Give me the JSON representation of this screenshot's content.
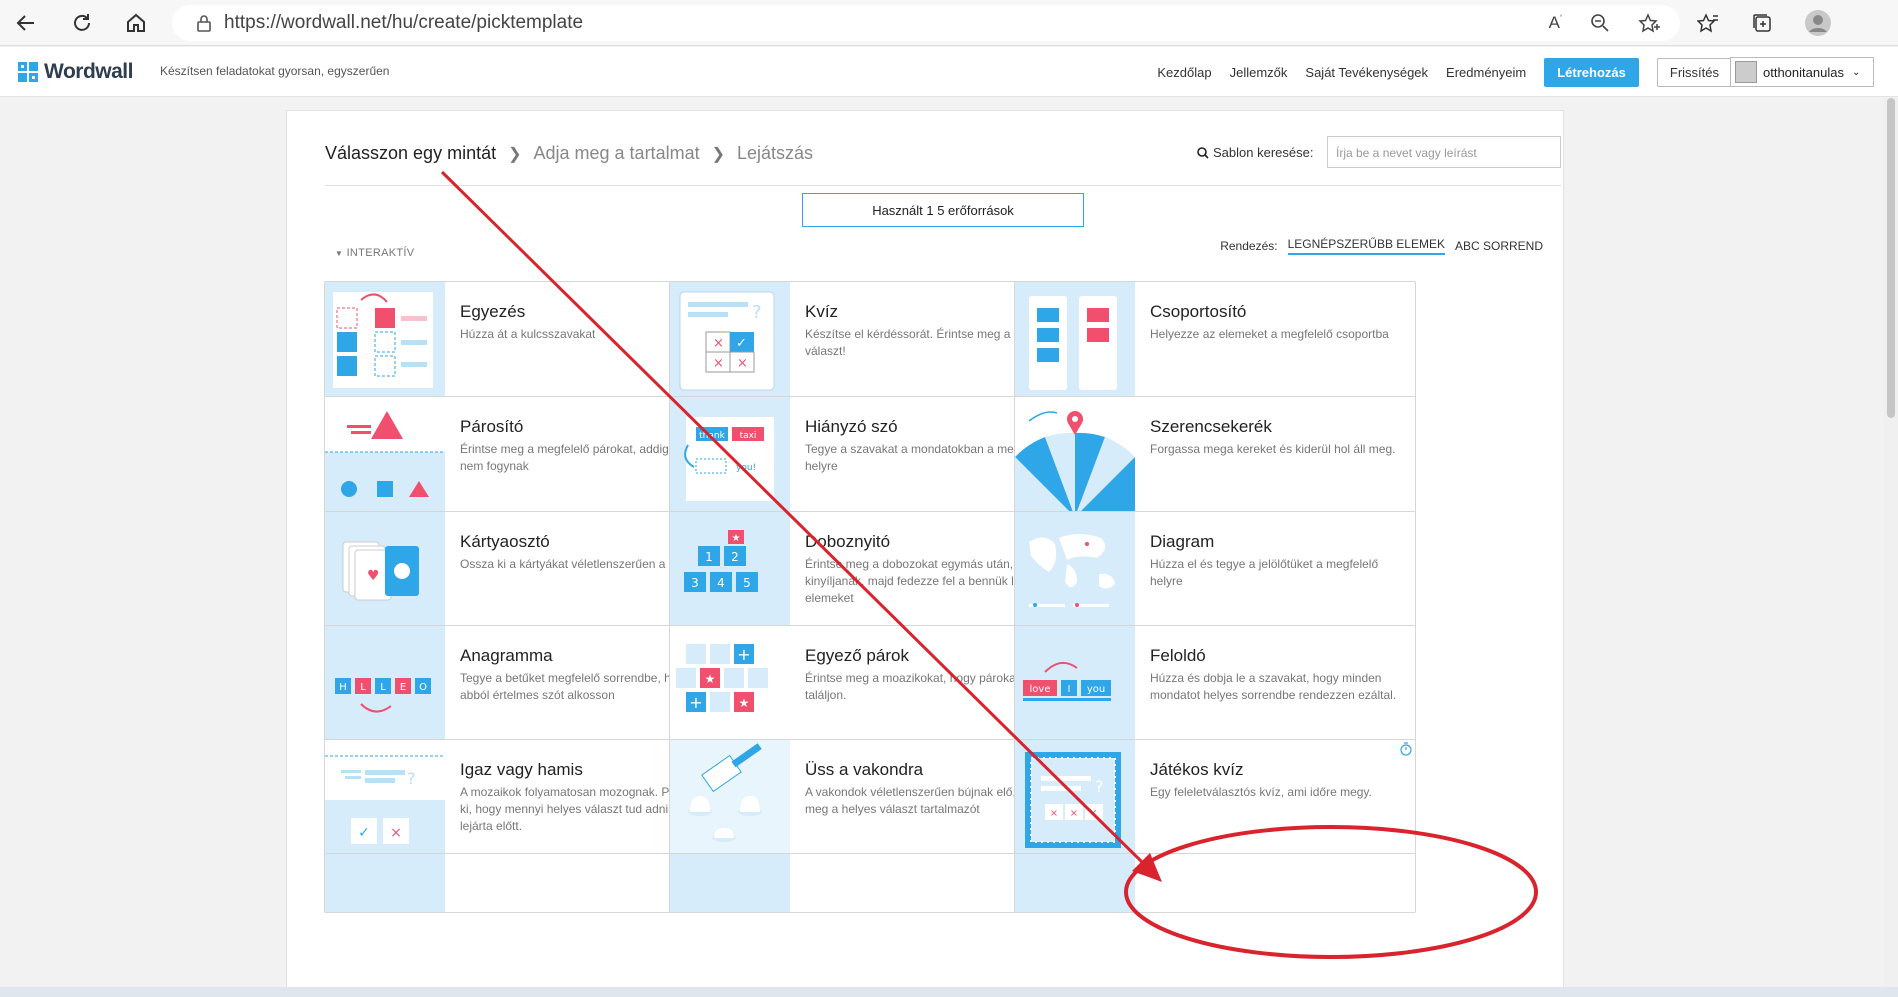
{
  "browser": {
    "url": "https://wordwall.net/hu/create/picktemplate"
  },
  "header": {
    "logo": "Wordwall",
    "tagline": "Készítsen feladatokat gyorsan, egyszerűen",
    "nav": [
      "Kezdőlap",
      "Jellemzők",
      "Saját Tevékenységek",
      "Eredményeim"
    ],
    "create_label": "Létrehozás",
    "upgrade_label": "Frissítés",
    "username": "otthonitanulas"
  },
  "breadcrumb": {
    "step1": "Válasszon egy mintát",
    "step2": "Adja meg a tartalmat",
    "step3": "Lejátszás"
  },
  "search": {
    "label": "Sablon keresése:",
    "placeholder": "Írja be a nevet vagy leírást"
  },
  "resources": "Használt 1 5 erőforrások",
  "section": "INTERAKTÍV",
  "sort": {
    "label": "Rendezés:",
    "popular": "LEGNÉPSZERŰBB ELEMEK",
    "abc": "ABC SORREND"
  },
  "templates": [
    {
      "title": "Egyezés",
      "desc": "Húzza át a kulcsszavakat"
    },
    {
      "title": "Kvíz",
      "desc": "Készítse el kérdéssorát. Érintse meg a helyes választ!"
    },
    {
      "title": "Csoportosító",
      "desc": "Helyezze az elemeket a megfelelő csoportba"
    },
    {
      "title": "Párosító",
      "desc": "Érintse meg a megfelelő párokat, addig, míg el nem fogynak"
    },
    {
      "title": "Hiányzó szó",
      "desc": "Tegye a szavakat a mondatokban a megfelelő helyre"
    },
    {
      "title": "Szerencsekerék",
      "desc": "Forgassa mega kereket és kiderül hol áll meg."
    },
    {
      "title": "Kártyaosztó",
      "desc": "Ossza ki a kártyákat véletlenszerűen a pakliból"
    },
    {
      "title": "Doboznyitó",
      "desc": "Érintse meg a dobozokat egymás után, hogy kinyíljanak, majd fedezze fel a bennük lévő elemeket"
    },
    {
      "title": "Diagram",
      "desc": "Húzza el és tegye a jelölőtüket a megfelelő helyre"
    },
    {
      "title": "Anagramma",
      "desc": "Tegye a betűket megfelelő sorrendbe, hogy abból értelmes szót alkosson"
    },
    {
      "title": "Egyező párok",
      "desc": "Érintse meg a moazikokat, hogy párokat találjon."
    },
    {
      "title": "Feloldó",
      "desc": "Húzza és dobja le a szavakat, hogy minden mondatot helyes sorrendbe rendezzen ezáltal."
    },
    {
      "title": "Igaz vagy hamis",
      "desc": "A mozaikok folyamatosan mozognak. Próbálja ki, hogy mennyi helyes választ tud adni az idő lejárta előtt."
    },
    {
      "title": "Üss a vakondra",
      "desc": "A vakondok véletlenszerűen bújnak elő, üsse meg a helyes választ tartalmazót"
    },
    {
      "title": "Játékos kvíz",
      "desc": "Egy feleletválasztós kvíz, ami időre megy."
    }
  ],
  "thumb_labels": {
    "thank": "thank",
    "taxi": "taxi",
    "you": "you!",
    "anagram": [
      "H",
      "L",
      "L",
      "E",
      "O"
    ],
    "unjumble": [
      "love",
      "I",
      "you"
    ],
    "box_numbers": [
      "1",
      "2",
      "3",
      "4",
      "5"
    ]
  },
  "colors": {
    "accent": "#2ea6e8",
    "thumb_bg": "#d7ecfa",
    "annotation": "#d9232d"
  }
}
